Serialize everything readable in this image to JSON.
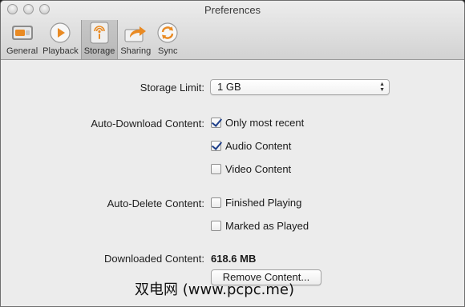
{
  "window": {
    "title": "Preferences"
  },
  "toolbar": {
    "items": [
      {
        "label": "General",
        "icon": "general-switch-icon",
        "selected": false
      },
      {
        "label": "Playback",
        "icon": "play-icon",
        "selected": false
      },
      {
        "label": "Storage",
        "icon": "storage-podcast-icon",
        "selected": true
      },
      {
        "label": "Sharing",
        "icon": "share-arrow-icon",
        "selected": false
      },
      {
        "label": "Sync",
        "icon": "sync-icon",
        "selected": false
      }
    ]
  },
  "storage": {
    "limit_label": "Storage Limit:",
    "limit_value": "1 GB",
    "auto_download_label": "Auto-Download Content:",
    "auto_download_options": [
      {
        "label": "Only most recent",
        "checked": true
      },
      {
        "label": "Audio Content",
        "checked": true
      },
      {
        "label": "Video Content",
        "checked": false
      }
    ],
    "auto_delete_label": "Auto-Delete Content:",
    "auto_delete_options": [
      {
        "label": "Finished Playing",
        "checked": false
      },
      {
        "label": "Marked as Played",
        "checked": false
      }
    ],
    "downloaded_label": "Downloaded Content:",
    "downloaded_value": "618.6 MB",
    "remove_button": "Remove Content..."
  },
  "watermark": "双电网 (www.pcpc.me)",
  "colors": {
    "accent_orange": "#e98a23",
    "check_blue": "#1e3f8a"
  }
}
